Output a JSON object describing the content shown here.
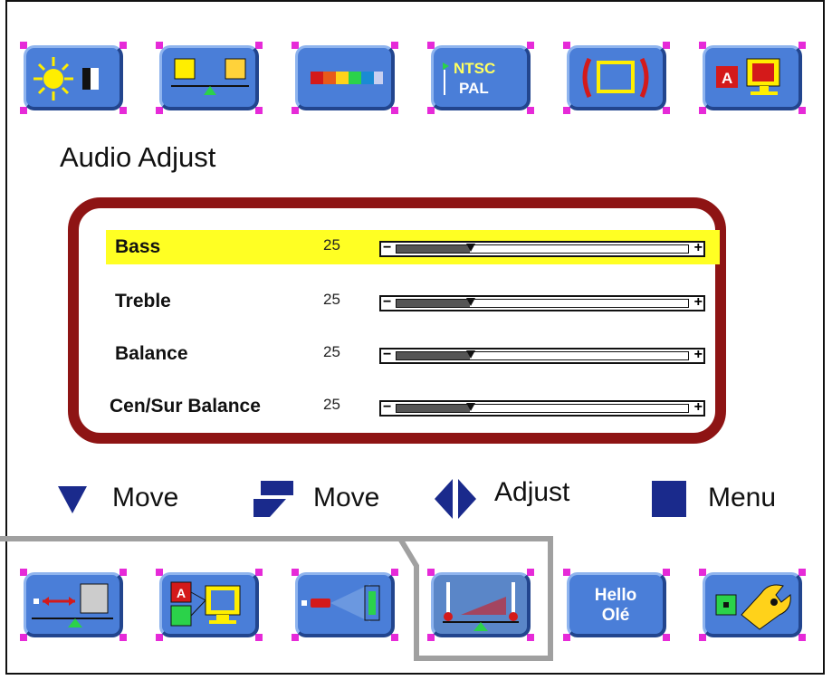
{
  "top_tiles": [
    {
      "icon": "brightness-contrast-icon"
    },
    {
      "icon": "color-balance-icon"
    },
    {
      "icon": "color-bars-icon"
    },
    {
      "icon": "ntsc-pal-icon",
      "text_line1": "NTSC",
      "text_line2": "PAL"
    },
    {
      "icon": "screen-size-icon"
    },
    {
      "icon": "input-source-icon",
      "text": "A"
    }
  ],
  "title": "Audio Adjust",
  "rows": [
    {
      "label": "Bass",
      "value": "25",
      "level": 25,
      "highlighted": true
    },
    {
      "label": "Treble",
      "value": "25",
      "level": 25,
      "highlighted": false
    },
    {
      "label": "Balance",
      "value": "25",
      "level": 25,
      "highlighted": false
    },
    {
      "label": "Cen/Sur Balance",
      "value": "25",
      "level": 25,
      "highlighted": false
    }
  ],
  "slider": {
    "minus": "−",
    "plus": "+"
  },
  "legend": {
    "move1": "Move",
    "move2": "Move",
    "adjust": "Adjust",
    "menu": "Menu"
  },
  "bottom_tiles": [
    {
      "icon": "image-position-icon"
    },
    {
      "icon": "multi-input-icon",
      "text": "A"
    },
    {
      "icon": "remote-sensor-icon"
    },
    {
      "icon": "audio-adjust-icon",
      "selected": true
    },
    {
      "icon": "language-icon",
      "text_line1": "Hello",
      "text_line2": "Olé"
    },
    {
      "icon": "tools-icon"
    }
  ],
  "colors": {
    "tile_blue": "#4a7ed8",
    "corner_magenta": "#e62ad8",
    "panel_border": "#8e1414",
    "highlight": "#ffff23",
    "legend_blue": "#1a2a8c"
  }
}
